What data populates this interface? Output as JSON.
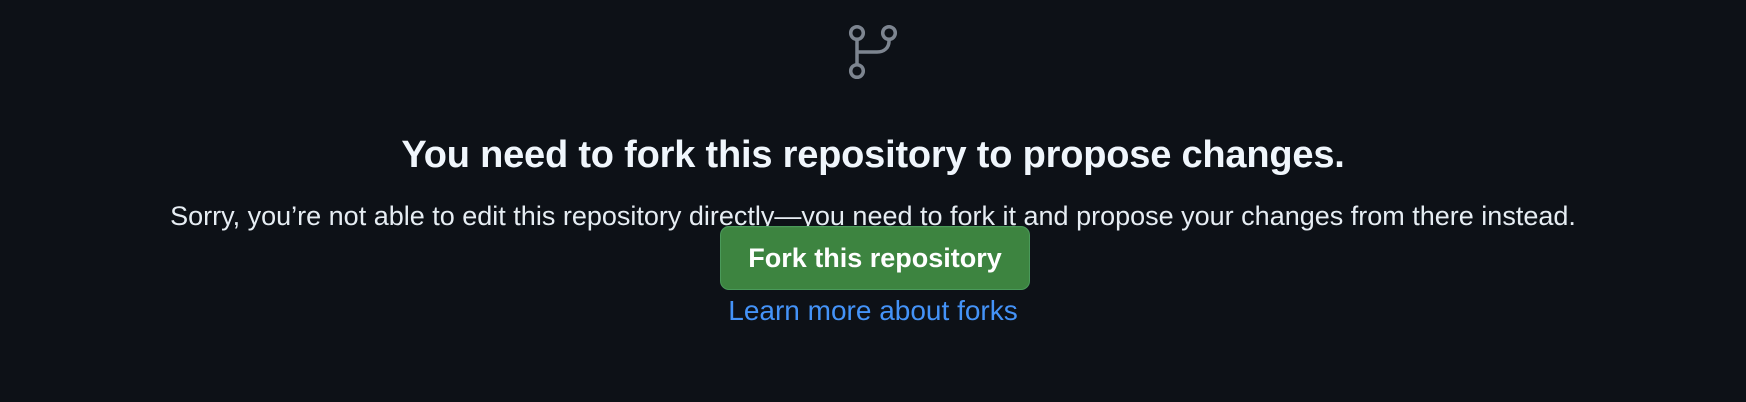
{
  "empty_state": {
    "icon": "repo-fork-icon",
    "title": "You need to fork this repository to propose changes.",
    "description": "Sorry, you’re not able to edit this repository directly—you need to fork it and propose your changes from there instead.",
    "primary_button_label": "Fork this repository",
    "learn_more_link": "Learn more about forks"
  },
  "colors": {
    "background": "#0d1117",
    "text_primary": "#f0f6fc",
    "icon": "#7d8590",
    "button": "#3d8440",
    "link": "#4493f8"
  }
}
